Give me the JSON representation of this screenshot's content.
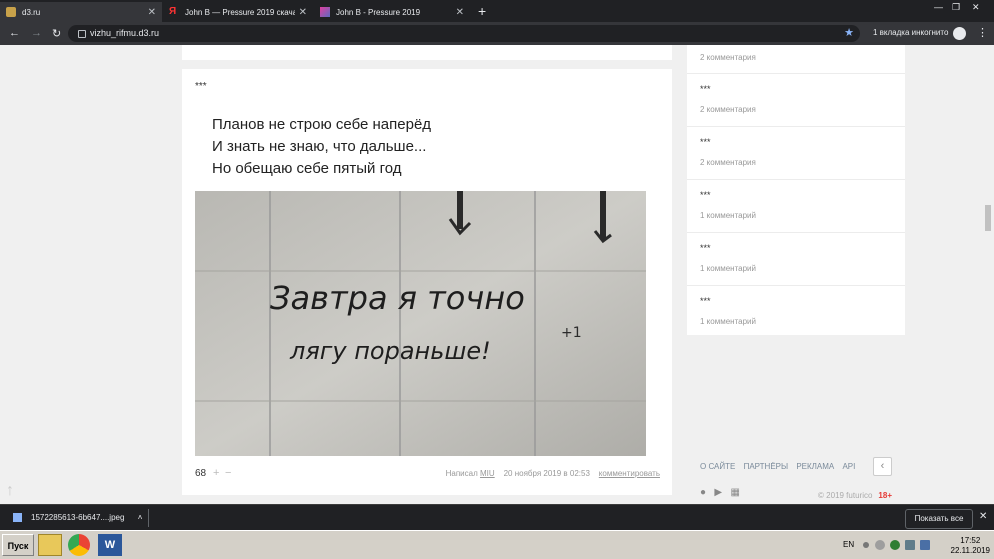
{
  "browser": {
    "tabs": [
      {
        "title": "d3.ru",
        "active": true
      },
      {
        "title": "John B — Pressure 2019 скачать ...",
        "active": false
      },
      {
        "title": "John B - Pressure 2019",
        "active": false
      }
    ],
    "url": "vizhu_rifmu.d3.ru",
    "incognito_label": "1 вкладка инкогнито"
  },
  "post": {
    "stars": "***",
    "poem_lines": [
      "Планов не строю себе наперёд",
      "И знать не знаю, что дальше...",
      "Но обещаю себе пятый год"
    ],
    "image_text_line1": "Завтра я точно",
    "image_text_line2": "лягу пораньше!",
    "image_mark": "+1",
    "rating": "68",
    "plus": "+",
    "minus": "−",
    "author_prefix": "Написал",
    "author": "MIU",
    "date": "20 ноября 2019 в 02:53",
    "comment_link": "комментировать"
  },
  "sidebar": {
    "items": [
      {
        "title": "",
        "comments": "2 комментария"
      },
      {
        "title": "***",
        "comments": "2 комментария"
      },
      {
        "title": "***",
        "comments": "2 комментария"
      },
      {
        "title": "***",
        "comments": "1 комментарий"
      },
      {
        "title": "***",
        "comments": "1 комментарий"
      },
      {
        "title": "***",
        "comments": "1 комментарий"
      }
    ],
    "footer_links": [
      "О САЙТЕ",
      "ПАРТНЁРЫ",
      "РЕКЛАМА",
      "API"
    ],
    "copyright": "© 2019 futurico",
    "age": "18+"
  },
  "downloads": {
    "file": "1572285613-6b647....jpeg",
    "show_all": "Показать все"
  },
  "taskbar": {
    "start": "Пуск",
    "lang": "EN",
    "time": "17:52",
    "date": "22.11.2019"
  }
}
